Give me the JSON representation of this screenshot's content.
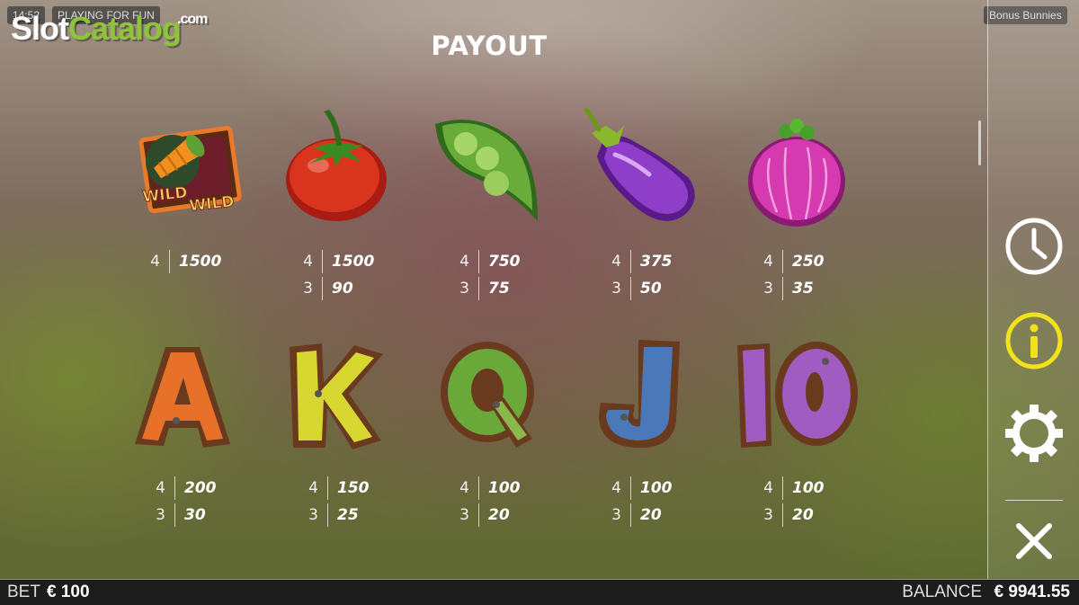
{
  "status": {
    "clock": "14:52",
    "mode": "PLAYING FOR FUN",
    "game_name": "Bonus Bunnies"
  },
  "watermark": {
    "part1": "Slot",
    "part2": "Catalog",
    "part3": ".com"
  },
  "title": "PAYOUT",
  "symbols_row1": [
    {
      "name": "wild",
      "icon": "wild-carrot-icon",
      "pays": [
        {
          "count": "4",
          "amount": "1500"
        }
      ]
    },
    {
      "name": "tomato",
      "icon": "tomato-icon",
      "pays": [
        {
          "count": "4",
          "amount": "1500"
        },
        {
          "count": "3",
          "amount": "90"
        }
      ]
    },
    {
      "name": "peas",
      "icon": "pea-pod-icon",
      "pays": [
        {
          "count": "4",
          "amount": "750"
        },
        {
          "count": "3",
          "amount": "75"
        }
      ]
    },
    {
      "name": "eggplant",
      "icon": "eggplant-icon",
      "pays": [
        {
          "count": "4",
          "amount": "375"
        },
        {
          "count": "3",
          "amount": "50"
        }
      ]
    },
    {
      "name": "onion",
      "icon": "onion-icon",
      "pays": [
        {
          "count": "4",
          "amount": "250"
        },
        {
          "count": "3",
          "amount": "35"
        }
      ]
    }
  ],
  "symbols_row2": [
    {
      "name": "A",
      "icon": "letter-a-icon",
      "color": "#e8712a",
      "pays": [
        {
          "count": "4",
          "amount": "200"
        },
        {
          "count": "3",
          "amount": "30"
        }
      ]
    },
    {
      "name": "K",
      "icon": "letter-k-icon",
      "color": "#d8d630",
      "pays": [
        {
          "count": "4",
          "amount": "150"
        },
        {
          "count": "3",
          "amount": "25"
        }
      ]
    },
    {
      "name": "Q",
      "icon": "letter-q-icon",
      "color": "#6aa83a",
      "pays": [
        {
          "count": "4",
          "amount": "100"
        },
        {
          "count": "3",
          "amount": "20"
        }
      ]
    },
    {
      "name": "J",
      "icon": "letter-j-icon",
      "color": "#4a78b8",
      "pays": [
        {
          "count": "4",
          "amount": "100"
        },
        {
          "count": "3",
          "amount": "20"
        }
      ]
    },
    {
      "name": "10",
      "icon": "letter-10-icon",
      "color": "#a05cc0",
      "pays": [
        {
          "count": "4",
          "amount": "100"
        },
        {
          "count": "3",
          "amount": "20"
        }
      ]
    }
  ],
  "wild_label": "WILD",
  "sidebar": [
    {
      "name": "history",
      "icon": "clock-icon",
      "color": "#ffffff"
    },
    {
      "name": "info",
      "icon": "info-icon",
      "color": "#f2e21c"
    },
    {
      "name": "settings",
      "icon": "gear-icon",
      "color": "#ffffff"
    },
    {
      "name": "close",
      "icon": "close-icon",
      "color": "#ffffff"
    }
  ],
  "footer": {
    "bet_label": "BET",
    "bet_value": "€ 100",
    "balance_label": "BALANCE",
    "balance_value": "€ 9941.55"
  }
}
